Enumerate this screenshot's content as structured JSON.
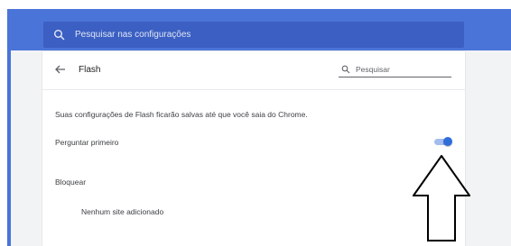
{
  "search": {
    "placeholder": "Pesquisar nas configurações",
    "icon": "search-icon"
  },
  "page": {
    "title": "Flash",
    "back_icon": "arrow-back-icon"
  },
  "page_search": {
    "placeholder": "Pesquisar",
    "icon": "search-icon"
  },
  "info_text": "Suas configurações de Flash ficarão salvas até que você saia do Chrome.",
  "ask_first": {
    "label": "Perguntar primeiro",
    "enabled": true
  },
  "block": {
    "label": "Bloquear",
    "empty_label": "Nenhum site adicionado"
  },
  "colors": {
    "header": "#4a74d8",
    "search_bar": "#3b5fc2",
    "toggle_on": "#2f6ddb",
    "toggle_track": "#a3bcee"
  }
}
